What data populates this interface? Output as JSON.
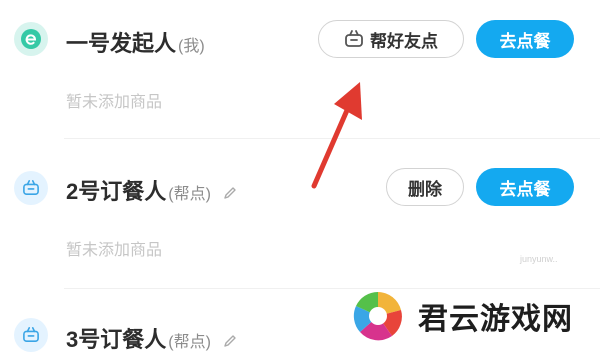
{
  "colors": {
    "primary": "#14a9f0",
    "arrow": "#e03a30"
  },
  "participants": [
    {
      "name": "一号发起人",
      "tag": "(我)",
      "empty_text": "暂未添加商品",
      "secondary_action": "帮好友点",
      "primary_action": "去点餐",
      "avatar_icon": "e-logo-icon"
    },
    {
      "name": "2号订餐人",
      "tag": "(帮点)",
      "empty_text": "暂未添加商品",
      "secondary_action": "删除",
      "primary_action": "去点餐",
      "avatar_icon": "basket-icon"
    },
    {
      "name": "3号订餐人",
      "tag": "(帮点)",
      "avatar_icon": "basket-icon"
    }
  ],
  "watermark": {
    "text": "君云游戏网",
    "small_text": "junyunw.."
  }
}
